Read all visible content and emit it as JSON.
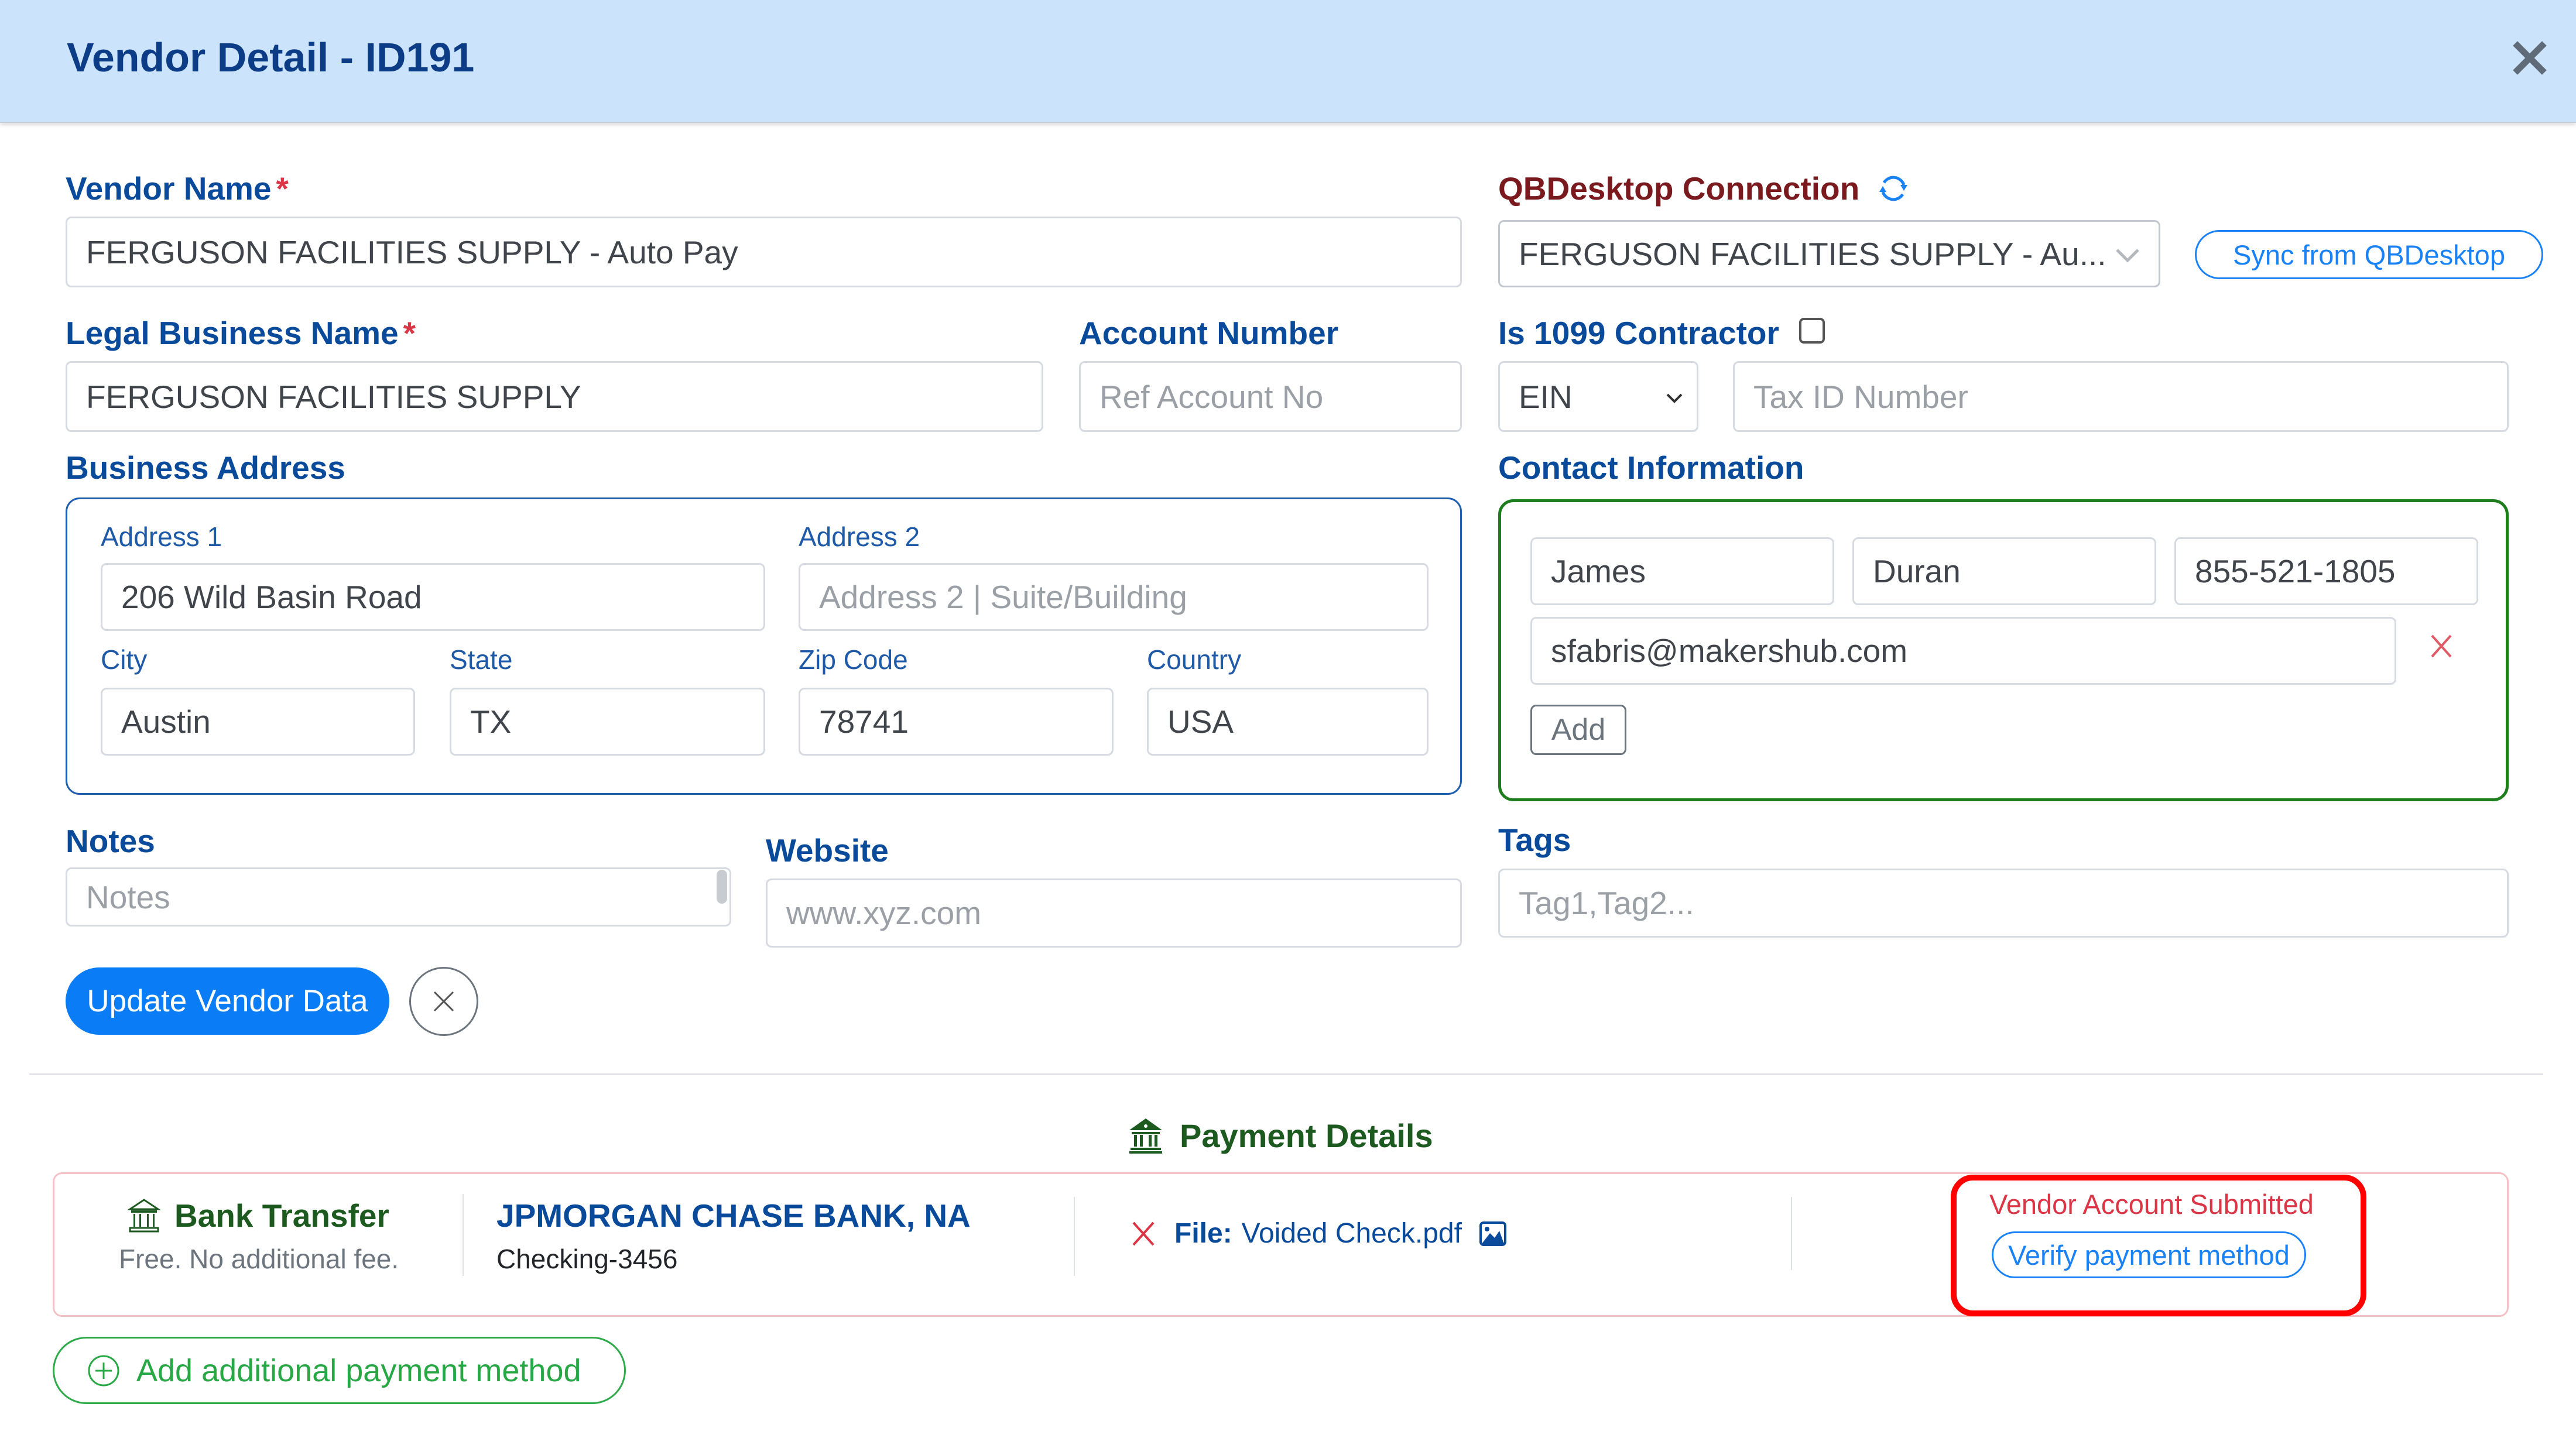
{
  "header": {
    "title": "Vendor Detail - ID191",
    "close_icon": "close-icon"
  },
  "vendor_name": {
    "label": "Vendor Name",
    "required_mark": "*",
    "value": "FERGUSON FACILITIES SUPPLY - Auto Pay"
  },
  "qbdesktop": {
    "label": "QBDesktop Connection",
    "refresh_icon": "refresh-icon",
    "selected": "FERGUSON FACILITIES SUPPLY - Au...",
    "sync_button": "Sync from QBDesktop"
  },
  "legal_name": {
    "label": "Legal Business Name",
    "required_mark": "*",
    "value": "FERGUSON FACILITIES SUPPLY"
  },
  "account_number": {
    "label": "Account Number",
    "placeholder": "Ref Account No",
    "value": ""
  },
  "contractor_1099": {
    "label": "Is 1099 Contractor",
    "checked": false,
    "tax_type_selected": "EIN",
    "tax_id_placeholder": "Tax ID Number",
    "tax_id_value": ""
  },
  "business_address": {
    "label": "Business Address",
    "address1": {
      "label": "Address 1",
      "value": "206 Wild Basin Road"
    },
    "address2": {
      "label": "Address 2",
      "placeholder": "Address 2 | Suite/Building",
      "value": ""
    },
    "city": {
      "label": "City",
      "value": "Austin"
    },
    "state": {
      "label": "State",
      "value": "TX"
    },
    "zip": {
      "label": "Zip Code",
      "value": "78741"
    },
    "country": {
      "label": "Country",
      "value": "USA"
    }
  },
  "contact": {
    "label": "Contact Information",
    "first_name": "James",
    "last_name": "Duran",
    "phone": "855-521-1805",
    "email": "sfabris@makershub.com",
    "add_button": "Add"
  },
  "notes": {
    "label": "Notes",
    "placeholder": "Notes",
    "value": ""
  },
  "website": {
    "label": "Website",
    "placeholder": "www.xyz.com",
    "value": ""
  },
  "tags": {
    "label": "Tags",
    "placeholder": "Tag1,Tag2...",
    "value": ""
  },
  "actions": {
    "update_button": "Update Vendor Data",
    "cancel_icon": "close-icon"
  },
  "payment": {
    "section_title": "Payment Details",
    "methods": [
      {
        "type": "Bank Transfer",
        "fee_note": "Free. No additional fee.",
        "bank_name": "JPMORGAN CHASE BANK, NA",
        "account": "Checking-3456",
        "file_label": "File:",
        "file_name": "Voided Check.pdf",
        "status": "Vendor Account Submitted",
        "verify_button": "Verify payment method"
      }
    ],
    "add_method_button": "Add additional payment method"
  },
  "colors": {
    "header_bg": "#cce4fb",
    "title": "#0b3c85",
    "label_blue": "#0a4a9b",
    "qbd_label": "#7a1a1e",
    "primary": "#0a7cf6",
    "success_green": "#28a745",
    "section_green": "#1d5a1f",
    "danger": "#dc3545",
    "highlight_red": "#ff0000"
  }
}
